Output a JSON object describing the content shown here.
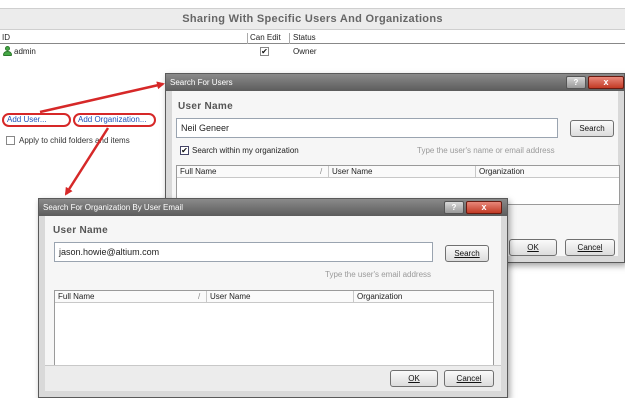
{
  "background": {
    "panel_title": "Sharing With Specific Users And Organizations",
    "columns": {
      "id": "ID",
      "can_edit": "Can Edit",
      "status": "Status"
    },
    "row": {
      "id": "admin",
      "can_edit_mark": "✔",
      "status": "Owner"
    },
    "add_user_label": "Add User...",
    "add_org_label": "Add Organization...",
    "apply_label": "Apply to child folders and items"
  },
  "users_dialog": {
    "title": "Search For Users",
    "help_btn": "?",
    "close_btn": "x",
    "section_label": "User Name",
    "input_value": "Neil Geneer",
    "search_btn": "Search",
    "within_org_label": "Search within my organization",
    "within_org_mark": "✔",
    "hint": "Type the user's name or email address",
    "columns": {
      "full_name": "Full Name",
      "sort": "/",
      "user_name": "User Name",
      "organization": "Organization"
    },
    "ok_btn": "OK",
    "cancel_btn": "Cancel"
  },
  "org_dialog": {
    "title": "Search For Organization By User Email",
    "help_btn": "?",
    "close_btn": "x",
    "section_label": "User Name",
    "input_value": "jason.howie@altium.com",
    "search_btn": "Search",
    "hint": "Type the user's email address",
    "columns": {
      "full_name": "Full Name",
      "sort": "/",
      "user_name": "User Name",
      "organization": "Organization"
    },
    "ok_btn": "OK",
    "cancel_btn": "Cancel"
  },
  "colors": {
    "highlight_red": "#d62828",
    "link_blue": "#1f52b8",
    "titlebar": "#6e6e6e"
  }
}
